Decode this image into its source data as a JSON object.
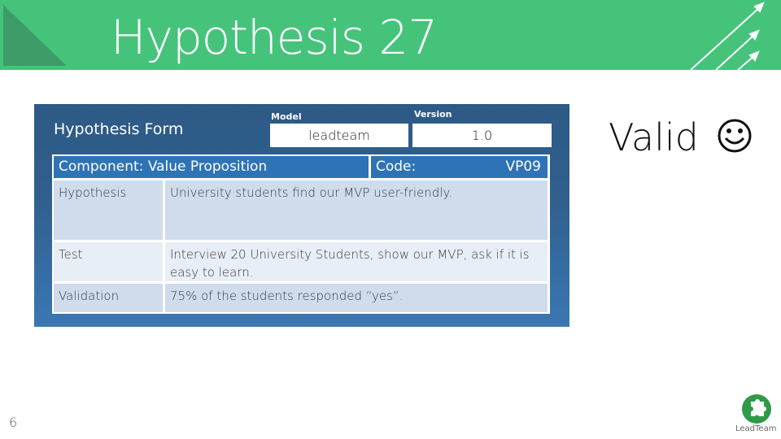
{
  "slide": {
    "title": "Hypothesis 27",
    "page_number": "6",
    "status_text": "Valid",
    "status_icon": "smiley-face-icon",
    "logo_text": "LeadTeam",
    "colors": {
      "header_green": "#45c37b",
      "header_triangle": "#3e9c68",
      "form_blue_dark": "#2d5a85",
      "form_blue_light": "#3a78b3",
      "table_header_blue": "#2e73b6",
      "row_light": "#d0dcec",
      "row_lighter": "#e8eef6"
    }
  },
  "form": {
    "title": "Hypothesis Form",
    "model_label": "Model",
    "model_value": "leadteam",
    "version_label": "Version",
    "version_value": "1.0",
    "component_label": "Component:  Value Proposition",
    "code_label": "Code:",
    "code_value": "VP09",
    "rows": [
      {
        "label": "Hypothesis",
        "value": "University students find our MVP user-friendly."
      },
      {
        "label": "Test",
        "value": "Interview 20 University Students, show our MVP, ask if it is easy to learn."
      },
      {
        "label": "Validation",
        "value": "75% of the students responded “yes”."
      }
    ]
  }
}
